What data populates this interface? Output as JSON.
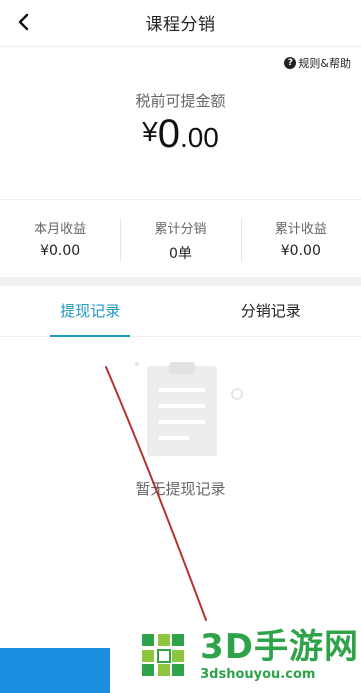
{
  "header": {
    "title": "课程分销",
    "back_icon": "chevron-left-icon"
  },
  "help": {
    "label": "规则&帮助",
    "icon_glyph": "?"
  },
  "balance": {
    "label": "税前可提金额",
    "currency": "¥",
    "integer": "0",
    "decimal": ".00"
  },
  "stats": [
    {
      "label": "本月收益",
      "value": "¥0.00"
    },
    {
      "label": "累计分销",
      "value": "0单"
    },
    {
      "label": "累计收益",
      "value": "¥0.00"
    }
  ],
  "tabs": [
    {
      "label": "提现记录",
      "active": true
    },
    {
      "label": "分销记录",
      "active": false
    }
  ],
  "empty_state": {
    "text": "暂无提现记录",
    "icon": "clipboard-icon"
  },
  "watermark": {
    "title": "3D手游网",
    "url": "3dshouyou.com"
  },
  "colors": {
    "accent": "#1f97c4",
    "watermark": "#2ea34a",
    "bottom_bar": "#1b8fe0"
  }
}
